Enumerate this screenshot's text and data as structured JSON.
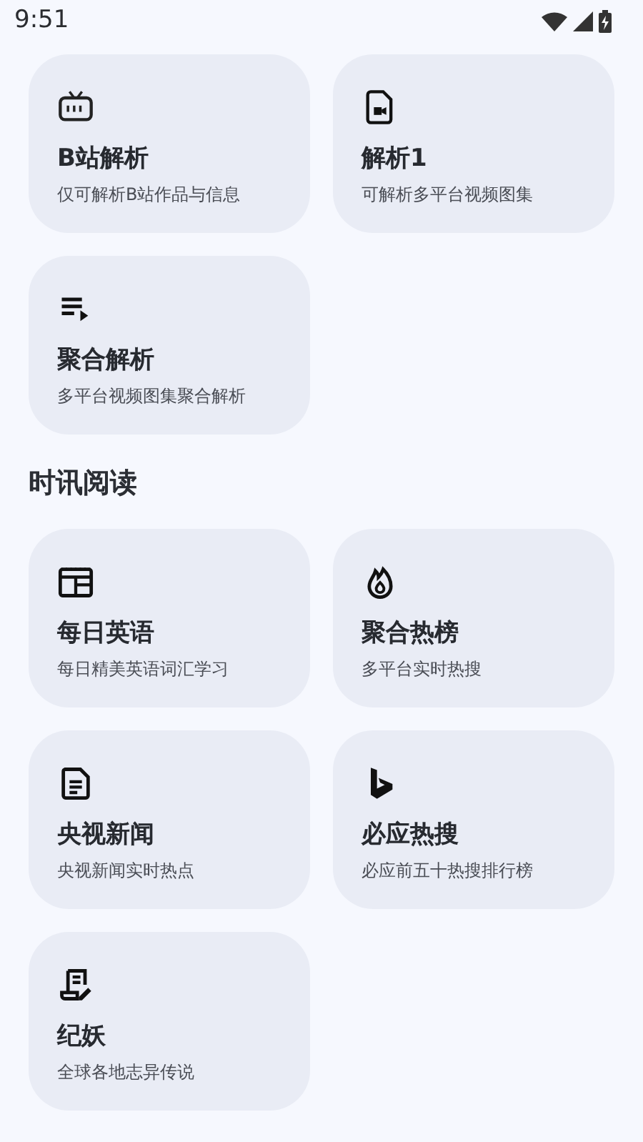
{
  "status_bar": {
    "time": "9:51"
  },
  "sections": [
    {
      "cards": [
        {
          "kind": "tv",
          "title": "B站解析",
          "subtitle": "仅可解析B站作品与信息"
        },
        {
          "kind": "videofile",
          "title": "解析1",
          "subtitle": "可解析多平台视频图集"
        },
        {
          "kind": "playlist",
          "title": "聚合解析",
          "subtitle": "多平台视频图集聚合解析"
        }
      ]
    },
    {
      "title": "时讯阅读",
      "cards": [
        {
          "kind": "newspaper",
          "title": "每日英语",
          "subtitle": "每日精美英语词汇学习"
        },
        {
          "kind": "flame",
          "title": "聚合热榜",
          "subtitle": "多平台实时热搜"
        },
        {
          "kind": "document",
          "title": "央视新闻",
          "subtitle": "央视新闻实时热点"
        },
        {
          "kind": "bing",
          "title": "必应热搜",
          "subtitle": "必应前五十热搜排行榜"
        },
        {
          "kind": "scroll",
          "title": "纪妖",
          "subtitle": "全球各地志异传说"
        }
      ]
    }
  ]
}
